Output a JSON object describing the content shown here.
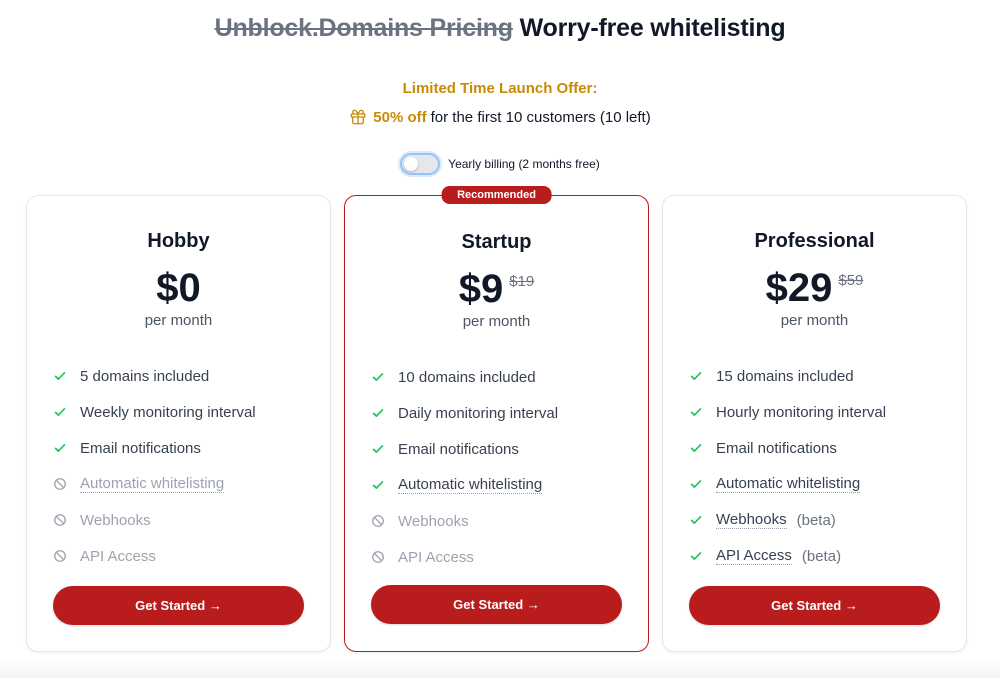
{
  "header": {
    "struck_title": "Unblock.Domains Pricing",
    "title": "Worry-free whitelisting"
  },
  "offer": {
    "title": "Limited Time Launch Offer:",
    "icon": "gift-icon",
    "percent": "50% off",
    "text": "for the first 10 customers (10 left)"
  },
  "billing": {
    "toggle_on": false,
    "label": "Yearly billing (2 months free)"
  },
  "colors": {
    "accent": "#b91c1c",
    "offer": "#ca8a04",
    "check": "#22c55e"
  },
  "plans": [
    {
      "name": "Hobby",
      "price": "$0",
      "old_price": "",
      "period": "per month",
      "recommended": false,
      "cta": "Get Started →",
      "features": [
        {
          "label": "5 domains included",
          "included": true,
          "dotted": false,
          "note": ""
        },
        {
          "label": "Weekly monitoring interval",
          "included": true,
          "dotted": false,
          "note": ""
        },
        {
          "label": "Email notifications",
          "included": true,
          "dotted": false,
          "note": ""
        },
        {
          "label": "Automatic whitelisting",
          "included": false,
          "dotted": true,
          "note": ""
        },
        {
          "label": "Webhooks",
          "included": false,
          "dotted": false,
          "note": ""
        },
        {
          "label": "API Access",
          "included": false,
          "dotted": false,
          "note": ""
        }
      ]
    },
    {
      "name": "Startup",
      "price": "$9",
      "old_price": "$19",
      "period": "per month",
      "recommended": true,
      "badge": "Recommended",
      "cta": "Get Started →",
      "features": [
        {
          "label": "10 domains included",
          "included": true,
          "dotted": false,
          "note": ""
        },
        {
          "label": "Daily monitoring interval",
          "included": true,
          "dotted": false,
          "note": ""
        },
        {
          "label": "Email notifications",
          "included": true,
          "dotted": false,
          "note": ""
        },
        {
          "label": "Automatic whitelisting",
          "included": true,
          "dotted": true,
          "note": ""
        },
        {
          "label": "Webhooks",
          "included": false,
          "dotted": false,
          "note": ""
        },
        {
          "label": "API Access",
          "included": false,
          "dotted": false,
          "note": ""
        }
      ]
    },
    {
      "name": "Professional",
      "price": "$29",
      "old_price": "$59",
      "period": "per month",
      "recommended": false,
      "cta": "Get Started →",
      "features": [
        {
          "label": "15 domains included",
          "included": true,
          "dotted": false,
          "note": ""
        },
        {
          "label": "Hourly monitoring interval",
          "included": true,
          "dotted": false,
          "note": ""
        },
        {
          "label": "Email notifications",
          "included": true,
          "dotted": false,
          "note": ""
        },
        {
          "label": "Automatic whitelisting",
          "included": true,
          "dotted": true,
          "note": ""
        },
        {
          "label": "Webhooks",
          "included": true,
          "dotted": true,
          "note": "(beta)"
        },
        {
          "label": "API Access",
          "included": true,
          "dotted": true,
          "note": "(beta)"
        }
      ]
    }
  ]
}
